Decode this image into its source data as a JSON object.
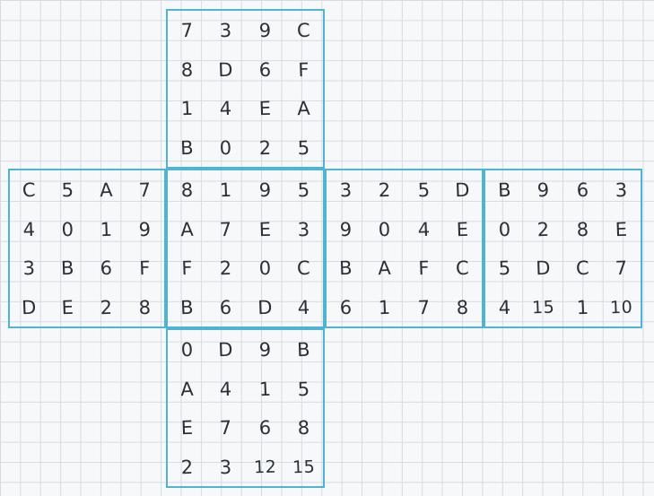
{
  "accent_color": "#4fb3d4",
  "faces": {
    "top": [
      "7",
      "3",
      "9",
      "C",
      "8",
      "D",
      "6",
      "F",
      "1",
      "4",
      "E",
      "A",
      "B",
      "0",
      "2",
      "5"
    ],
    "left": [
      "C",
      "5",
      "A",
      "7",
      "4",
      "0",
      "1",
      "9",
      "3",
      "B",
      "6",
      "F",
      "D",
      "E",
      "2",
      "8"
    ],
    "center": [
      "8",
      "1",
      "9",
      "5",
      "A",
      "7",
      "E",
      "3",
      "F",
      "2",
      "0",
      "C",
      "B",
      "6",
      "D",
      "4"
    ],
    "right": [
      "3",
      "2",
      "5",
      "D",
      "9",
      "0",
      "4",
      "E",
      "B",
      "A",
      "F",
      "C",
      "6",
      "1",
      "7",
      "8"
    ],
    "far": [
      "B",
      "9",
      "6",
      "3",
      "0",
      "2",
      "8",
      "E",
      "5",
      "D",
      "C",
      "7",
      "4",
      "15",
      "1",
      "10"
    ],
    "bottom": [
      "0",
      "D",
      "9",
      "B",
      "A",
      "4",
      "1",
      "5",
      "E",
      "7",
      "6",
      "8",
      "2",
      "3",
      "12",
      "15"
    ]
  }
}
